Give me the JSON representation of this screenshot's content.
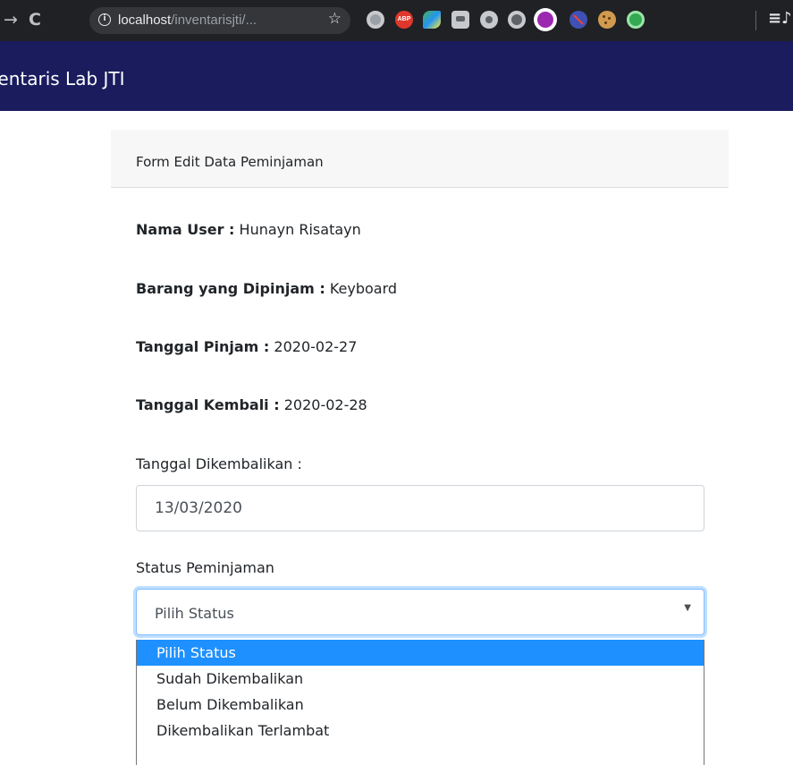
{
  "browser": {
    "url_host": "localhost",
    "url_path": "/inventarisjti/..."
  },
  "navbar": {
    "brand": "Inventaris Lab JTI"
  },
  "card": {
    "title": "Form Edit Data Peminjaman"
  },
  "info": {
    "user_label": "Nama User :",
    "user_value": "Hunayn Risatayn",
    "item_label": "Barang yang Dipinjam :",
    "item_value": "Keyboard",
    "borrow_date_label": "Tanggal Pinjam :",
    "borrow_date_value": "2020-02-27",
    "due_date_label": "Tanggal Kembali :",
    "due_date_value": "2020-02-28"
  },
  "form": {
    "returned_date_label": "Tanggal Dikembalikan :",
    "returned_date_value": "13/03/2020",
    "status_label": "Status Peminjaman",
    "status_selected": "Pilih Status",
    "status_options": [
      "Pilih Status",
      "Sudah Dikembalikan",
      "Belum Dikembalikan",
      "Dikembalikan Terlambat"
    ]
  },
  "colors": {
    "navbar_bg": "#1a1c5e",
    "option_highlight": "#1e90ff"
  }
}
